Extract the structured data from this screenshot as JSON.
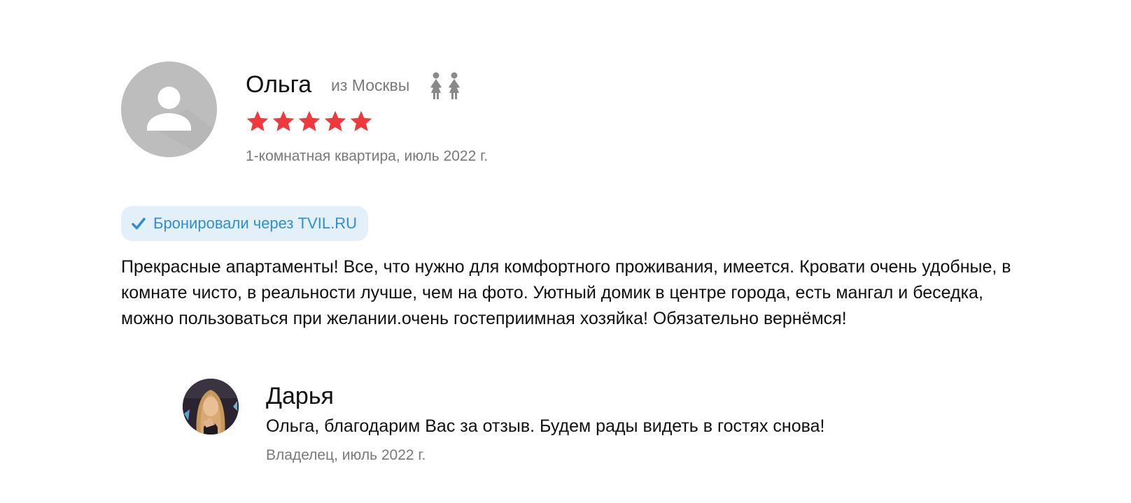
{
  "review": {
    "author": {
      "name": "Ольга",
      "city": "из Москвы",
      "avatar_icon": "default-user-avatar-icon",
      "guests_icon": "two-women-icon"
    },
    "rating": {
      "value": 5,
      "max": 5,
      "star_color": "#f0393c"
    },
    "stay_info": "1-комнатная квартира, июль 2022 г.",
    "badge": {
      "icon": "checkmark-icon",
      "label": "Бронировали через TVIL.RU",
      "text_color": "#2f8fd6",
      "background": "#e3f0fa"
    },
    "text": "Прекрасные апартаменты! Все, что нужно для комфортного проживания, имеется. Кровати очень удобные, в комнате чисто, в реальности лучше, чем на фото. Уютный домик в центре города, есть мангал и беседка, можно пользоваться при желании.очень гостеприимная хозяйка! Обязательно вернёмся!"
  },
  "reply": {
    "author": {
      "name": "Дарья",
      "avatar_icon": "owner-photo-avatar"
    },
    "text": "Ольга, благодарим Вас за отзыв. Будем рады видеть в гостях снова!",
    "meta": "Владелец, июль 2022 г."
  }
}
